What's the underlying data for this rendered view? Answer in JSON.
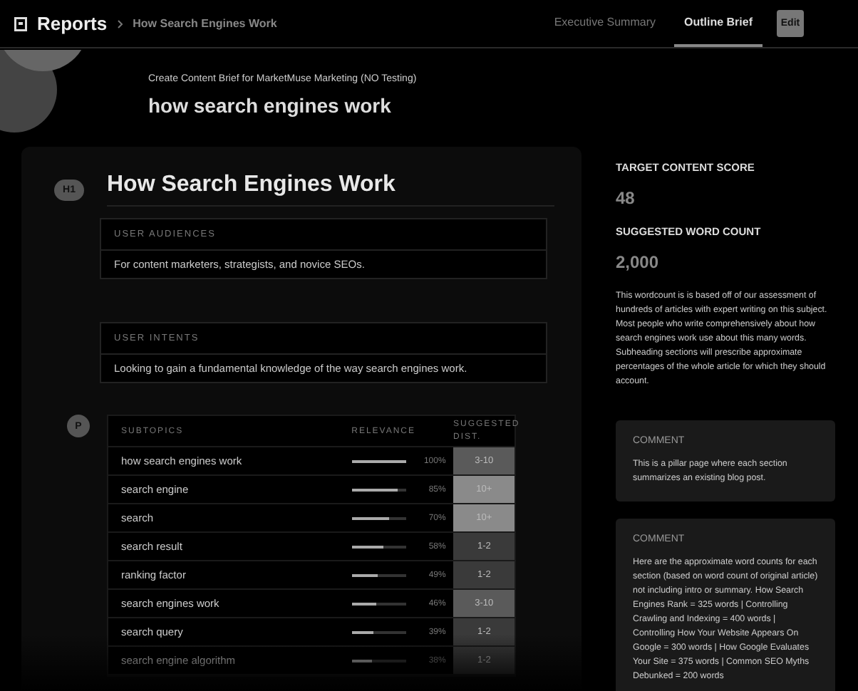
{
  "header": {
    "title": "Reports",
    "breadcrumb": "How Search Engines Work",
    "tabs": [
      {
        "label": "Executive Summary",
        "selected": false
      },
      {
        "label": "Outline Brief",
        "selected": true
      }
    ],
    "edit_button": "Edit"
  },
  "subtitle": "Create Content Brief for MarketMuse Marketing (NO Testing)",
  "topic": "how search engines work",
  "outline": {
    "badge": "H1",
    "heading": "How Search Engines Work",
    "sections": [
      {
        "label": "USER AUDIENCES",
        "text": "For content marketers, strategists, and novice SEOs."
      },
      {
        "label": "USER INTENTS",
        "text": "Looking to gain a fundamental knowledge of the way search engines work."
      }
    ],
    "table": {
      "badge": "P",
      "columns": [
        "SUBTOPICS",
        "RELEVANCE",
        "SUGGESTED DIST."
      ],
      "rows": [
        {
          "topic": "how search engines work",
          "level": 1.0,
          "relevance": "100%",
          "dist": "3-10",
          "color": "#5a5a5a"
        },
        {
          "topic": "search engine",
          "level": 0.85,
          "relevance": "85%",
          "dist": "10+",
          "color": "#8a8a8a"
        },
        {
          "topic": "search",
          "level": 0.7,
          "relevance": "70%",
          "dist": "10+",
          "color": "#8a8a8a"
        },
        {
          "topic": "search result",
          "level": 0.58,
          "relevance": "58%",
          "dist": "1-2",
          "color": "#3a3a3a"
        },
        {
          "topic": "ranking factor",
          "level": 0.49,
          "relevance": "49%",
          "dist": "1-2",
          "color": "#3a3a3a"
        },
        {
          "topic": "search engines work",
          "level": 0.46,
          "relevance": "46%",
          "dist": "3-10",
          "color": "#5a5a5a"
        },
        {
          "topic": "search query",
          "level": 0.39,
          "relevance": "39%",
          "dist": "1-2",
          "color": "#3a3a3a"
        },
        {
          "topic": "search engine algorithm",
          "level": 0.38,
          "relevance": "38%",
          "dist": "1-2",
          "color": "#3a3a3a"
        }
      ]
    }
  },
  "sidebar": {
    "score_label": "TARGET CONTENT SCORE",
    "score": "48",
    "count_label": "SUGGESTED WORD COUNT",
    "count": "2,000",
    "note": "This wordcount is is based off of our assessment of hundreds of articles with expert writing on this subject. Most people who write comprehensively about how search engines work use about this many words. Subheading sections will prescribe approximate percentages of the whole article for which they should account.",
    "comments": [
      {
        "label": "COMMENT",
        "text": "This is a pillar page where each section summarizes an existing blog post."
      },
      {
        "label": "COMMENT",
        "text": "Here are the approximate word counts for each section (based on word count of original article) not including intro or summary. How Search Engines Rank = 325 words | Controlling Crawling and Indexing = 400 words | Controlling How Your Website Appears On Google = 300 words | How Google Evaluates Your Site = 375 words | Common SEO Myths Debunked = 200 words"
      }
    ]
  }
}
